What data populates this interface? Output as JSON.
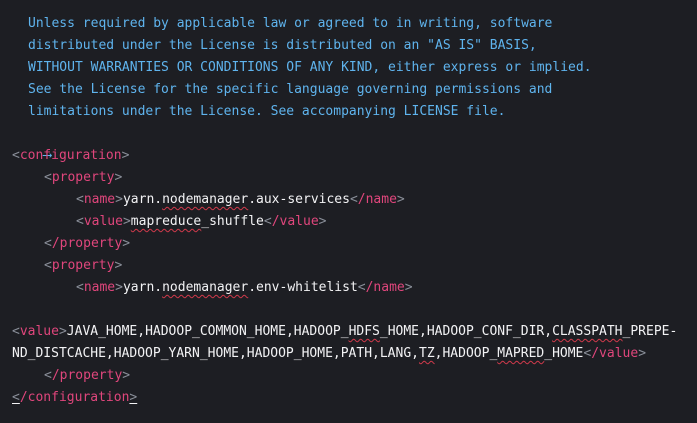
{
  "editor": {
    "comment_lines": [
      "Unless required by applicable law or agreed to in writing, software",
      "distributed under the License is distributed on an \"AS IS\" BASIS,",
      "WITHOUT WARRANTIES OR CONDITIONS OF ANY KIND, either express or implied.",
      "See the License for the specific language governing permissions and",
      "limitations under the License. See accompanying LICENSE file."
    ],
    "comment_close": "-->",
    "tags": {
      "configuration_open": "configuration",
      "configuration_close": "/configuration",
      "property_open": "property",
      "property_close": "/property",
      "name_open": "name",
      "name_close": "/name",
      "value_open": "value",
      "value_close": "/value"
    },
    "properties": [
      {
        "name_prefix": "yarn.",
        "name_squig": "nodemanager",
        "name_suffix": ".aux-services",
        "value_squig": "mapreduce",
        "value_suffix": "_shuffle"
      },
      {
        "name_prefix": "yarn.",
        "name_squig": "nodemanager",
        "name_suffix": ".env-whitelist",
        "value_line1_a": "JAVA_HOME,HADOOP_COMMON_HOME,HADOOP_",
        "value_line1_b": "HDFS",
        "value_line1_c": "_HOME,HADOOP_CONF_DIR,",
        "value_line1_d": "CLASSPATH",
        "value_line1_e": "_PREPE-",
        "value_line2_a": "ND_DISTCACHE,HADOOP_YARN_HOME,HADOOP_HOME,PATH,LANG,",
        "value_line2_b": "TZ",
        "value_line2_c": ",HADOOP_",
        "value_line2_d": "MAPRED",
        "value_line2_e": "_HOME"
      }
    ],
    "colors": {
      "background": "#1d1e23",
      "comment": "#5fb4ee",
      "tag": "#e0467c",
      "bracket": "#8a8f99",
      "text": "#f3f3f5",
      "squiggle": "#d03a4b"
    }
  }
}
